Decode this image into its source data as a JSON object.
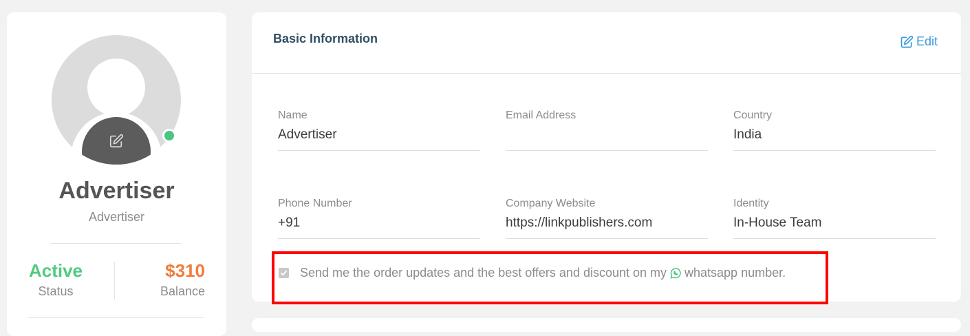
{
  "profile": {
    "name": "Advertiser",
    "role": "Advertiser",
    "status_value": "Active",
    "status_label": "Status",
    "balance_value": "$310",
    "balance_label": "Balance",
    "online_color": "#4cc582",
    "avatar_icon": "user-placeholder-icon",
    "avatar_edit_icon": "edit-icon"
  },
  "basic_info": {
    "title": "Basic Information",
    "edit_label": "Edit",
    "edit_icon": "edit-icon",
    "fields": {
      "name": {
        "label": "Name",
        "value": "Advertiser"
      },
      "email": {
        "label": "Email Address",
        "value": ""
      },
      "country": {
        "label": "Country",
        "value": "India"
      },
      "phone": {
        "label": "Phone Number",
        "value": "+91"
      },
      "website": {
        "label": "Company Website",
        "value": "https://linkpublishers.com"
      },
      "identity": {
        "label": "Identity",
        "value": "In-House Team"
      }
    },
    "consent": {
      "checked": true,
      "text_before": "Send me the order updates and the best offers and discount on my",
      "icon": "whatsapp-icon",
      "text_after": "whatsapp number."
    }
  },
  "colors": {
    "status_active": "#52c97f",
    "balance": "#f07c3a",
    "link": "#3a9ad9",
    "whatsapp": "#4cc582",
    "highlight": "#ff0000"
  }
}
